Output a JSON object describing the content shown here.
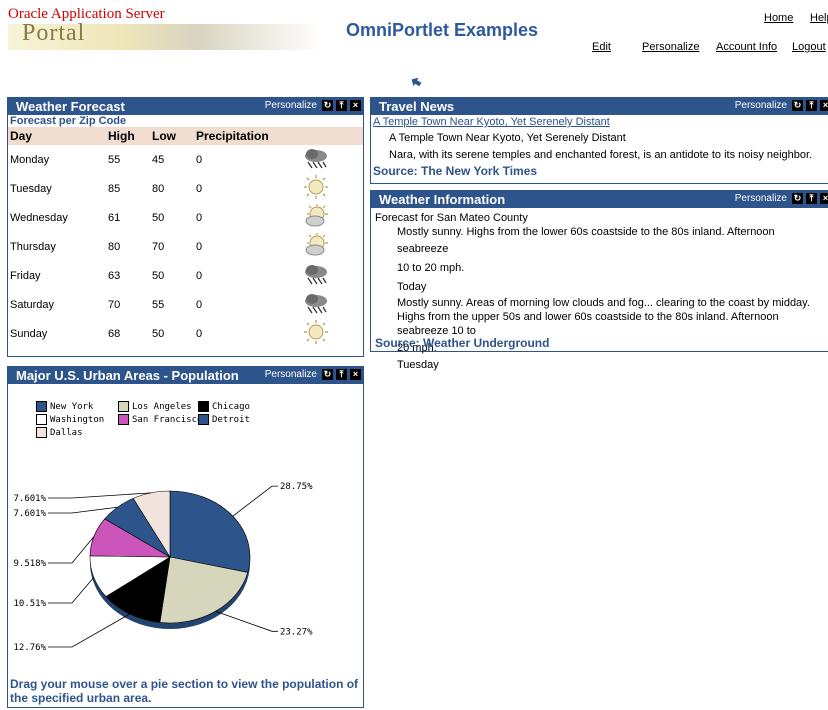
{
  "header": {
    "brand_line1": "Oracle Application Server",
    "brand_line2": "Portal",
    "page_title": "OmniPortlet Examples",
    "top_links": [
      "Home",
      "Help"
    ],
    "nav_links": [
      "Edit",
      "Personalize",
      "Account Info",
      "Logout"
    ],
    "up_icon": "up-arrow-icon"
  },
  "weather_forecast": {
    "title": "Weather Forecast",
    "personalize": "Personalize",
    "subtitle": "Forecast per Zip Code",
    "columns": [
      "Day",
      "High",
      "Low",
      "Precipitation"
    ],
    "rows": [
      {
        "day": "Monday",
        "high": "55",
        "low": "45",
        "precip": "0",
        "icon": "storm"
      },
      {
        "day": "Tuesday",
        "high": "85",
        "low": "80",
        "precip": "0",
        "icon": "sun"
      },
      {
        "day": "Wednesday",
        "high": "61",
        "low": "50",
        "precip": "0",
        "icon": "partly-cloudy"
      },
      {
        "day": "Thursday",
        "high": "80",
        "low": "70",
        "precip": "0",
        "icon": "partly-cloudy"
      },
      {
        "day": "Friday",
        "high": "63",
        "low": "50",
        "precip": "0",
        "icon": "storm"
      },
      {
        "day": "Saturday",
        "high": "70",
        "low": "55",
        "precip": "0",
        "icon": "storm"
      },
      {
        "day": "Sunday",
        "high": "68",
        "low": "50",
        "precip": "0",
        "icon": "sun"
      }
    ]
  },
  "travel_news": {
    "title": "Travel News",
    "personalize": "Personalize",
    "headline_link": "A Temple Town Near Kyoto, Yet Serenely Distant",
    "headline": "A Temple Town Near Kyoto, Yet Serenely Distant",
    "summary": "Nara, with its serene temples and enchanted forest, is an antidote to its noisy neighbor.",
    "source": "Source: The New York Times"
  },
  "weather_info": {
    "title": "Weather Information",
    "personalize": "Personalize",
    "heading": "Forecast for San Mateo County",
    "p1": "Mostly sunny. Highs from the lower 60s coastside to the 80s inland. Afternoon seabreeze",
    "p1b": "10 to 20 mph.",
    "label_today": "Today",
    "p2": "Mostly sunny. Areas of morning low clouds and fog... clearing to the coast by midday. Highs from the upper 50s and lower 60s coastside to the 80s inland. Afternoon seabreeze 10 to",
    "p2b": "20 mph.",
    "label_tuesday": "Tuesday",
    "source": "Source: Weather Underground"
  },
  "population": {
    "title": "Major U.S. Urban Areas - Population",
    "personalize": "Personalize",
    "note": "Drag your mouse over a pie section to view the population of the specified urban area."
  },
  "chart_data": {
    "type": "pie",
    "title": "",
    "legend_position": "top-left",
    "categories": [
      "New York",
      "Los Angeles",
      "Chicago",
      "Washington",
      "San Francisco",
      "Detroit",
      "Dallas"
    ],
    "values": [
      28.75,
      23.27,
      12.76,
      10.51,
      9.518,
      7.601,
      7.601
    ],
    "value_labels": [
      "28.75%",
      "23.27%",
      "12.76%",
      "10.51%",
      "9.518%",
      "7.601%",
      "7.601%"
    ],
    "colors": [
      "#2e548c",
      "#d6d6bc",
      "#000000",
      "#ffffff",
      "#cc55bb",
      "#2e548c",
      "#f1e4dc"
    ]
  }
}
